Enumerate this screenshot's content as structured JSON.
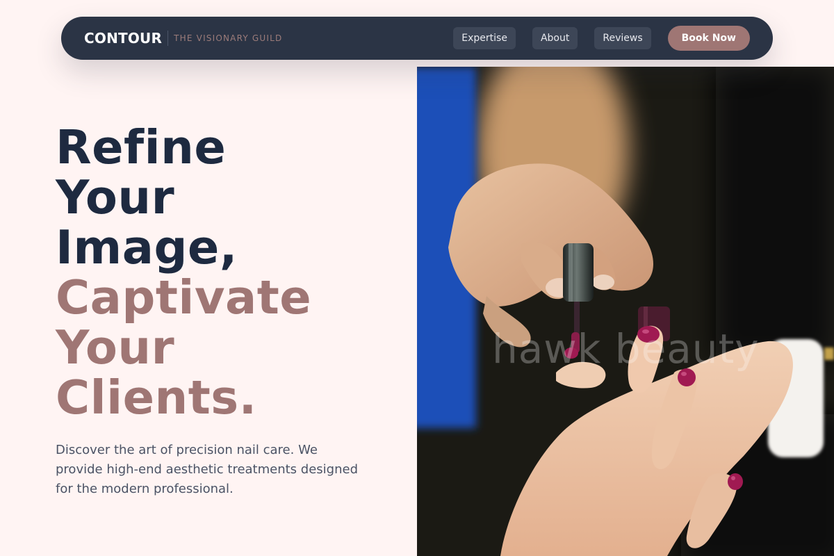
{
  "nav": {
    "brand": "CONTOUR",
    "tagline": "THE VISIONARY GUILD",
    "links": [
      {
        "label": "Expertise"
      },
      {
        "label": "About"
      },
      {
        "label": "Reviews"
      }
    ],
    "cta": "Book Now"
  },
  "hero": {
    "headline_dark": [
      "Refine",
      "Your",
      "Image,"
    ],
    "headline_accent": [
      "Captivate",
      "Your",
      "Clients."
    ],
    "subtitle": "Discover the art of precision nail care. We provide high-end aesthetic treatments designed for the modern professional.",
    "image": {
      "subject": "manicure-photo",
      "watermark": "hawk beauty"
    }
  },
  "colors": {
    "page_bg": "#fff4f3",
    "nav_bg": "#2b3445",
    "headline_dark": "#1e2a40",
    "accent": "#9f7674",
    "body_text": "#4b5365",
    "polish": "#a01a52"
  }
}
